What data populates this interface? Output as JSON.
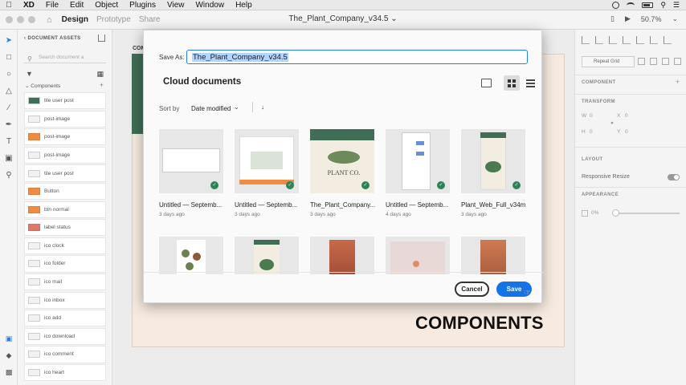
{
  "menubar": {
    "app_name": "XD",
    "items": [
      "File",
      "Edit",
      "Object",
      "Plugins",
      "View",
      "Window",
      "Help"
    ]
  },
  "toolbar": {
    "tabs": [
      "Design",
      "Prototype",
      "Share"
    ],
    "active_tab": "Design",
    "document_title": "The_Plant_Company_v34.5",
    "zoom": "50.7%"
  },
  "assets": {
    "header": "DOCUMENT ASSETS",
    "search_placeholder": "Search document a",
    "section": "Components",
    "items": [
      {
        "label": "tile user post",
        "thumb": "t-green"
      },
      {
        "label": "post-image",
        "thumb": "t-light"
      },
      {
        "label": "post-image",
        "thumb": "t-orange"
      },
      {
        "label": "post-image",
        "thumb": "t-light"
      },
      {
        "label": "tile user post",
        "thumb": "t-light"
      },
      {
        "label": "Button",
        "thumb": "t-orange"
      },
      {
        "label": "btn normal",
        "thumb": "t-orange"
      },
      {
        "label": "label status",
        "thumb": "t-red"
      },
      {
        "label": "ico clock",
        "thumb": "t-light"
      },
      {
        "label": "ico folder",
        "thumb": "t-light"
      },
      {
        "label": "ico mail",
        "thumb": "t-light"
      },
      {
        "label": "ico inbox",
        "thumb": "t-light"
      },
      {
        "label": "ico add",
        "thumb": "t-light"
      },
      {
        "label": "ico download",
        "thumb": "t-light"
      },
      {
        "label": "ico comment",
        "thumb": "t-light"
      },
      {
        "label": "ico heart",
        "thumb": "t-light"
      }
    ]
  },
  "canvas": {
    "artboard_label": "COM",
    "components_heading": "COMPONENTS"
  },
  "props": {
    "repeat_grid": "Repeat Grid",
    "component_label": "COMPONENT",
    "transform_label": "TRANSFORM",
    "w_label": "W",
    "w_value": "0",
    "x_label": "X",
    "x_value": "0",
    "h_label": "H",
    "h_value": "0",
    "y_label": "Y",
    "y_value": "0",
    "layout_label": "LAYOUT",
    "responsive_resize": "Responsive Resize",
    "appearance_label": "APPEARANCE",
    "opacity": "0%"
  },
  "dialog": {
    "save_as_label": "Save As:",
    "save_as_value": "The_Plant_Company_v34.5",
    "location_title": "Cloud documents",
    "sort_by_label": "Sort by",
    "sort_by_value": "Date modified",
    "files": [
      {
        "name": "Untitled — Septemb...",
        "date": "3 days ago"
      },
      {
        "name": "Untitled — Septemb...",
        "date": "3 days ago"
      },
      {
        "name": "The_Plant_Company...",
        "date": "3 days ago"
      },
      {
        "name": "Untitled — Septemb...",
        "date": "4 days ago"
      },
      {
        "name": "Plant_Web_Full_v34m",
        "date": "3 days ago"
      }
    ],
    "cancel_label": "Cancel",
    "save_label": "Save",
    "plant_thumb_text": "PLANT CO."
  }
}
